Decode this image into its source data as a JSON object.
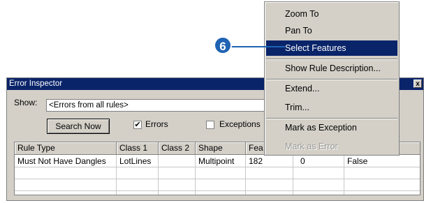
{
  "callout": {
    "number": "6"
  },
  "window": {
    "title": "Error Inspector",
    "close_glyph": "x",
    "show_label": "Show:",
    "show_value": "<Errors from all rules>",
    "search_button": "Search Now",
    "errors_label": "Errors",
    "errors_checked": "✔",
    "exceptions_label": "Exceptions"
  },
  "table": {
    "columns": [
      "Rule Type",
      "Class 1",
      "Class 2",
      "Shape",
      "Fea",
      "",
      ""
    ],
    "rows": [
      [
        "Must Not Have Dangles",
        "LotLines",
        "",
        "Multipoint",
        "182",
        "0",
        "False"
      ]
    ]
  },
  "context_menu": {
    "items": [
      {
        "label": "Zoom To",
        "state": "normal"
      },
      {
        "label": "Pan To",
        "state": "normal"
      },
      {
        "label": "Select Features",
        "state": "highlighted"
      },
      {
        "label": "Show Rule Description...",
        "state": "normal"
      },
      {
        "label": "Extend...",
        "state": "normal"
      },
      {
        "label": "Trim...",
        "state": "normal"
      },
      {
        "label": "Mark as Exception",
        "state": "normal"
      },
      {
        "label": "Mark as Error",
        "state": "disabled"
      }
    ]
  },
  "colors": {
    "highlight": "#0a246a",
    "callout": "#1f63b3",
    "face": "#d4d0c8"
  }
}
